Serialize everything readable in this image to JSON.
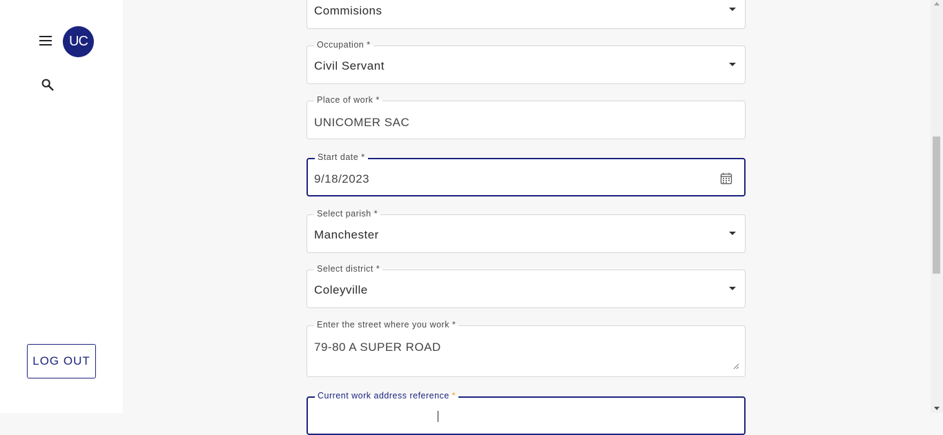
{
  "sidebar": {
    "avatar_text": "UC",
    "logout_label": "LOG OUT",
    "icons": [
      "menu-icon",
      "search-icon"
    ]
  },
  "form": {
    "commission": {
      "value": "Commisions"
    },
    "occupation": {
      "label": "Occupation",
      "value": "Civil Servant"
    },
    "place_of_work": {
      "label": "Place of work",
      "value": "UNICOMER SAC"
    },
    "start_date": {
      "label": "Start date",
      "value": "9/18/2023"
    },
    "parish": {
      "label": "Select parish",
      "value": "Manchester"
    },
    "district": {
      "label": "Select district",
      "value": "Coleyville"
    },
    "street": {
      "label": "Enter the street where you work",
      "value": "79-80 A SUPER ROAD"
    },
    "work_address_reference": {
      "label": "Current work address reference",
      "value": ""
    },
    "required_marker": "*"
  },
  "colors": {
    "accent": "#1a237e",
    "required_star_focused": "#f0a030",
    "border": "#d6d6d6"
  }
}
